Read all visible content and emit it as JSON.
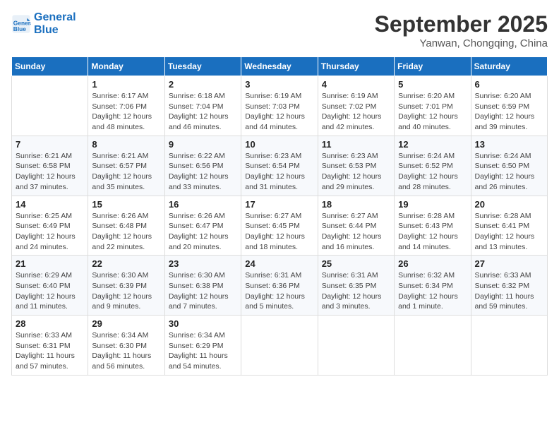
{
  "header": {
    "logo_line1": "General",
    "logo_line2": "Blue",
    "month": "September 2025",
    "location": "Yanwan, Chongqing, China"
  },
  "weekdays": [
    "Sunday",
    "Monday",
    "Tuesday",
    "Wednesday",
    "Thursday",
    "Friday",
    "Saturday"
  ],
  "weeks": [
    [
      {
        "day": "",
        "sunrise": "",
        "sunset": "",
        "daylight": ""
      },
      {
        "day": "1",
        "sunrise": "Sunrise: 6:17 AM",
        "sunset": "Sunset: 7:06 PM",
        "daylight": "Daylight: 12 hours and 48 minutes."
      },
      {
        "day": "2",
        "sunrise": "Sunrise: 6:18 AM",
        "sunset": "Sunset: 7:04 PM",
        "daylight": "Daylight: 12 hours and 46 minutes."
      },
      {
        "day": "3",
        "sunrise": "Sunrise: 6:19 AM",
        "sunset": "Sunset: 7:03 PM",
        "daylight": "Daylight: 12 hours and 44 minutes."
      },
      {
        "day": "4",
        "sunrise": "Sunrise: 6:19 AM",
        "sunset": "Sunset: 7:02 PM",
        "daylight": "Daylight: 12 hours and 42 minutes."
      },
      {
        "day": "5",
        "sunrise": "Sunrise: 6:20 AM",
        "sunset": "Sunset: 7:01 PM",
        "daylight": "Daylight: 12 hours and 40 minutes."
      },
      {
        "day": "6",
        "sunrise": "Sunrise: 6:20 AM",
        "sunset": "Sunset: 6:59 PM",
        "daylight": "Daylight: 12 hours and 39 minutes."
      }
    ],
    [
      {
        "day": "7",
        "sunrise": "Sunrise: 6:21 AM",
        "sunset": "Sunset: 6:58 PM",
        "daylight": "Daylight: 12 hours and 37 minutes."
      },
      {
        "day": "8",
        "sunrise": "Sunrise: 6:21 AM",
        "sunset": "Sunset: 6:57 PM",
        "daylight": "Daylight: 12 hours and 35 minutes."
      },
      {
        "day": "9",
        "sunrise": "Sunrise: 6:22 AM",
        "sunset": "Sunset: 6:56 PM",
        "daylight": "Daylight: 12 hours and 33 minutes."
      },
      {
        "day": "10",
        "sunrise": "Sunrise: 6:23 AM",
        "sunset": "Sunset: 6:54 PM",
        "daylight": "Daylight: 12 hours and 31 minutes."
      },
      {
        "day": "11",
        "sunrise": "Sunrise: 6:23 AM",
        "sunset": "Sunset: 6:53 PM",
        "daylight": "Daylight: 12 hours and 29 minutes."
      },
      {
        "day": "12",
        "sunrise": "Sunrise: 6:24 AM",
        "sunset": "Sunset: 6:52 PM",
        "daylight": "Daylight: 12 hours and 28 minutes."
      },
      {
        "day": "13",
        "sunrise": "Sunrise: 6:24 AM",
        "sunset": "Sunset: 6:50 PM",
        "daylight": "Daylight: 12 hours and 26 minutes."
      }
    ],
    [
      {
        "day": "14",
        "sunrise": "Sunrise: 6:25 AM",
        "sunset": "Sunset: 6:49 PM",
        "daylight": "Daylight: 12 hours and 24 minutes."
      },
      {
        "day": "15",
        "sunrise": "Sunrise: 6:26 AM",
        "sunset": "Sunset: 6:48 PM",
        "daylight": "Daylight: 12 hours and 22 minutes."
      },
      {
        "day": "16",
        "sunrise": "Sunrise: 6:26 AM",
        "sunset": "Sunset: 6:47 PM",
        "daylight": "Daylight: 12 hours and 20 minutes."
      },
      {
        "day": "17",
        "sunrise": "Sunrise: 6:27 AM",
        "sunset": "Sunset: 6:45 PM",
        "daylight": "Daylight: 12 hours and 18 minutes."
      },
      {
        "day": "18",
        "sunrise": "Sunrise: 6:27 AM",
        "sunset": "Sunset: 6:44 PM",
        "daylight": "Daylight: 12 hours and 16 minutes."
      },
      {
        "day": "19",
        "sunrise": "Sunrise: 6:28 AM",
        "sunset": "Sunset: 6:43 PM",
        "daylight": "Daylight: 12 hours and 14 minutes."
      },
      {
        "day": "20",
        "sunrise": "Sunrise: 6:28 AM",
        "sunset": "Sunset: 6:41 PM",
        "daylight": "Daylight: 12 hours and 13 minutes."
      }
    ],
    [
      {
        "day": "21",
        "sunrise": "Sunrise: 6:29 AM",
        "sunset": "Sunset: 6:40 PM",
        "daylight": "Daylight: 12 hours and 11 minutes."
      },
      {
        "day": "22",
        "sunrise": "Sunrise: 6:30 AM",
        "sunset": "Sunset: 6:39 PM",
        "daylight": "Daylight: 12 hours and 9 minutes."
      },
      {
        "day": "23",
        "sunrise": "Sunrise: 6:30 AM",
        "sunset": "Sunset: 6:38 PM",
        "daylight": "Daylight: 12 hours and 7 minutes."
      },
      {
        "day": "24",
        "sunrise": "Sunrise: 6:31 AM",
        "sunset": "Sunset: 6:36 PM",
        "daylight": "Daylight: 12 hours and 5 minutes."
      },
      {
        "day": "25",
        "sunrise": "Sunrise: 6:31 AM",
        "sunset": "Sunset: 6:35 PM",
        "daylight": "Daylight: 12 hours and 3 minutes."
      },
      {
        "day": "26",
        "sunrise": "Sunrise: 6:32 AM",
        "sunset": "Sunset: 6:34 PM",
        "daylight": "Daylight: 12 hours and 1 minute."
      },
      {
        "day": "27",
        "sunrise": "Sunrise: 6:33 AM",
        "sunset": "Sunset: 6:32 PM",
        "daylight": "Daylight: 11 hours and 59 minutes."
      }
    ],
    [
      {
        "day": "28",
        "sunrise": "Sunrise: 6:33 AM",
        "sunset": "Sunset: 6:31 PM",
        "daylight": "Daylight: 11 hours and 57 minutes."
      },
      {
        "day": "29",
        "sunrise": "Sunrise: 6:34 AM",
        "sunset": "Sunset: 6:30 PM",
        "daylight": "Daylight: 11 hours and 56 minutes."
      },
      {
        "day": "30",
        "sunrise": "Sunrise: 6:34 AM",
        "sunset": "Sunset: 6:29 PM",
        "daylight": "Daylight: 11 hours and 54 minutes."
      },
      {
        "day": "",
        "sunrise": "",
        "sunset": "",
        "daylight": ""
      },
      {
        "day": "",
        "sunrise": "",
        "sunset": "",
        "daylight": ""
      },
      {
        "day": "",
        "sunrise": "",
        "sunset": "",
        "daylight": ""
      },
      {
        "day": "",
        "sunrise": "",
        "sunset": "",
        "daylight": ""
      }
    ]
  ]
}
